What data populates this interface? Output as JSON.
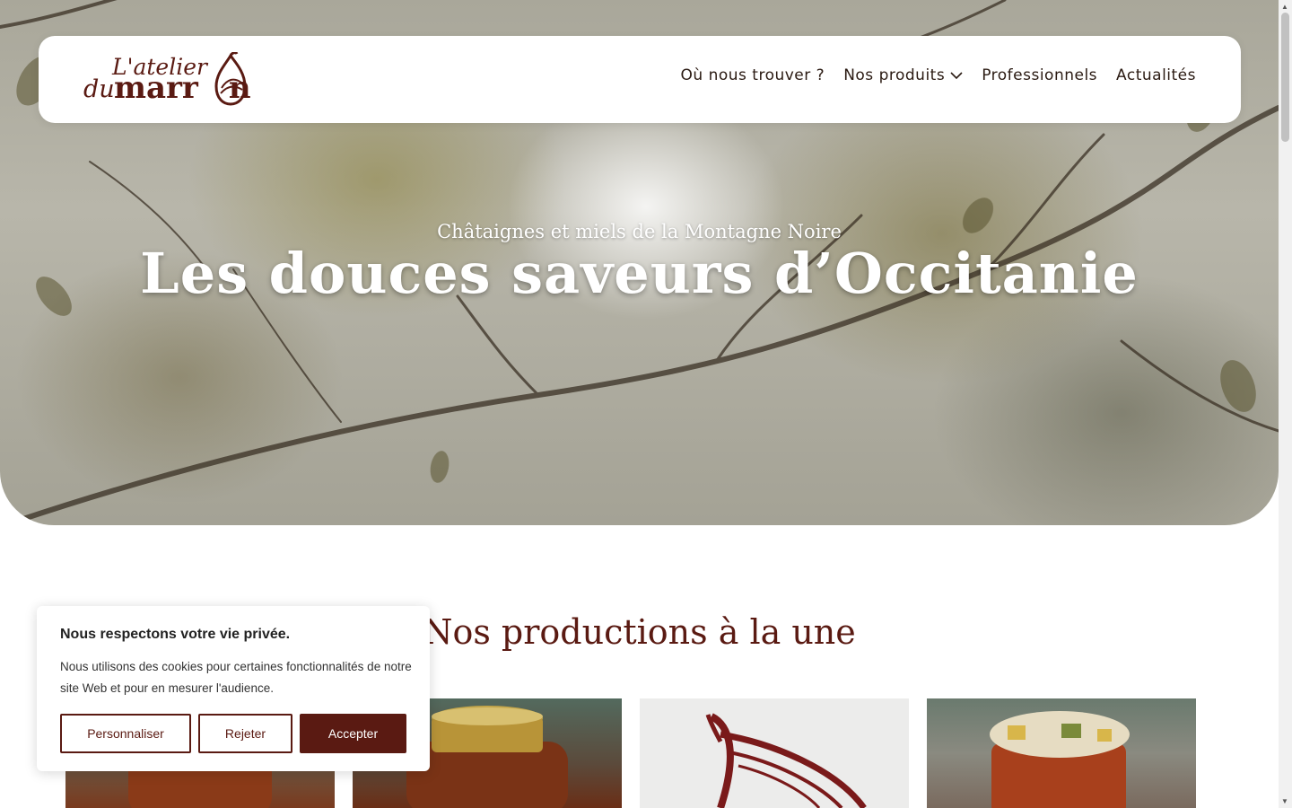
{
  "header": {
    "logo": {
      "line1": "L'atelier",
      "du": "du",
      "word": "marr",
      "end": "n"
    },
    "nav": [
      {
        "label": "Où nous trouver ?"
      },
      {
        "label": "Nos produits",
        "has_dropdown": true
      },
      {
        "label": "Professionnels"
      },
      {
        "label": "Actualités"
      }
    ]
  },
  "hero": {
    "subtitle": "Châtaignes et miels de la Montagne Noire",
    "title": "Les douces saveurs d’Occitanie"
  },
  "section": {
    "title": "Nos productions à la une"
  },
  "cookie": {
    "title": "Nous respectons votre vie privée.",
    "text": "Nous utilisons des cookies pour certaines fonctionnalités de notre site Web et pour en mesurer l'audience.",
    "buttons": {
      "customize": "Personnaliser",
      "reject": "Rejeter",
      "accept": "Accepter"
    }
  },
  "colors": {
    "brand": "#5a1a12",
    "text": "#2a1a12",
    "white": "#ffffff"
  }
}
